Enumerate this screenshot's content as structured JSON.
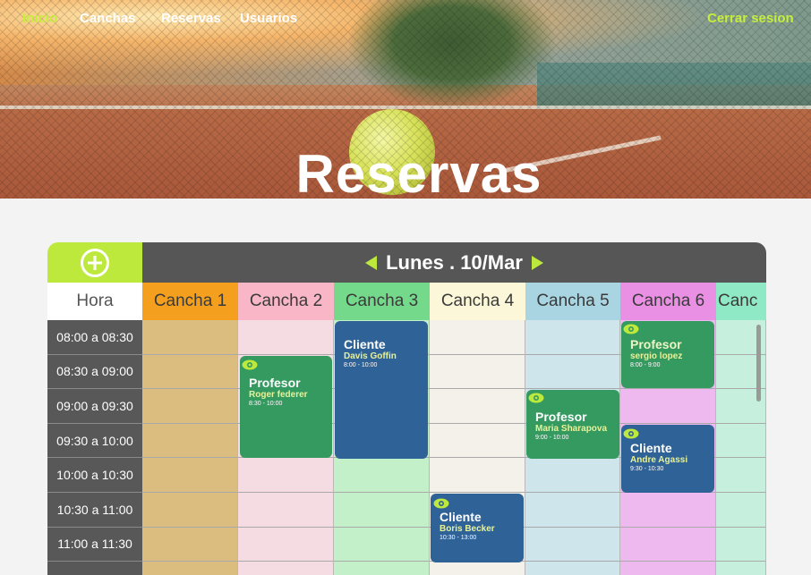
{
  "nav": {
    "inicio": "Inicio",
    "canchas": "Canchas",
    "reservas": "Reservas",
    "usuarios": "Usuarios",
    "logout": "Cerrar sesion"
  },
  "hero": {
    "title": "Reservas"
  },
  "scheduler": {
    "date": "Lunes . 10/Mar",
    "hora_label": "Hora",
    "times": [
      "08:00 a 08:30",
      "08:30 a 09:00",
      "09:00 a 09:30",
      "09:30 a 10:00",
      "10:00 a 10:30",
      "10:30 a 11:00",
      "11:00 a 11:30"
    ],
    "courts": [
      {
        "name": "Cancha 1",
        "header_color": "#f4a01e",
        "cell_color": "#dcbd80"
      },
      {
        "name": "Cancha 2",
        "header_color": "#f8b6c6",
        "cell_color": "#f5dbe2"
      },
      {
        "name": "Cancha 3",
        "header_color": "#74d98b",
        "cell_color": "#c3f0c8"
      },
      {
        "name": "Cancha 4",
        "header_color": "#fbf7d8",
        "cell_color": "#f3f1ea"
      },
      {
        "name": "Cancha 5",
        "header_color": "#a9d5e3",
        "cell_color": "#cfe5ec"
      },
      {
        "name": "Cancha 6",
        "header_color": "#e98fe4",
        "cell_color": "#edb9ee"
      },
      {
        "name": "Canc",
        "header_color": "#8ee9c4",
        "cell_color": "#c6efdd"
      }
    ],
    "reservations": [
      {
        "kind": "Profesor",
        "person": "Roger federer",
        "time": "8:30 - 10:00",
        "color": "green"
      },
      {
        "kind": "Cliente",
        "person": "Davis Goffin",
        "time": "8:00 - 10:00",
        "color": "blue"
      },
      {
        "kind": "Cliente",
        "person": "Boris Becker",
        "time": "10:30 - 13:00",
        "color": "blue"
      },
      {
        "kind": "Profesor",
        "person": "Maria Sharapova",
        "time": "9:00 - 10:00",
        "color": "green"
      },
      {
        "kind": "Profesor",
        "person": "sergio lopez",
        "time": "8:00 - 9:00",
        "color": "green"
      },
      {
        "kind": "Cliente",
        "person": "Andre Agassi",
        "time": "9:30 - 10:30",
        "color": "blue"
      }
    ]
  }
}
